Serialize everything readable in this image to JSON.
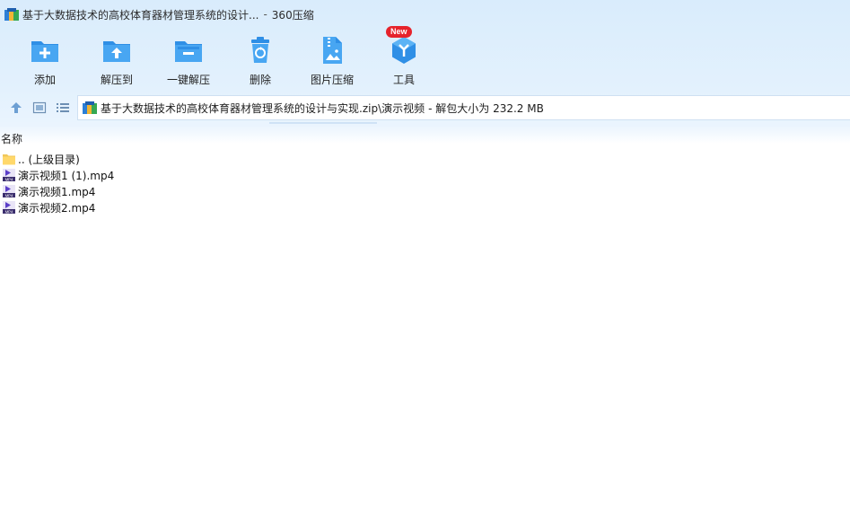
{
  "window": {
    "title": "基于大数据技术的高校体育器材管理系统的设计...",
    "separator": "-",
    "app_name": "360压缩"
  },
  "toolbar": {
    "items": [
      {
        "label": "添加",
        "icon": "add-folder-icon"
      },
      {
        "label": "解压到",
        "icon": "extract-to-icon"
      },
      {
        "label": "一键解压",
        "icon": "one-click-extract-icon"
      },
      {
        "label": "删除",
        "icon": "delete-recycle-icon"
      },
      {
        "label": "图片压缩",
        "icon": "image-compress-icon"
      },
      {
        "label": "工具",
        "icon": "tools-icon",
        "badge": "New"
      }
    ]
  },
  "navigation": {
    "path": "基于大数据技术的高校体育器材管理系统的设计与实现.zip\\演示视频",
    "info": "- 解包大小为 232.2 MB"
  },
  "list": {
    "column_name": "名称",
    "items": [
      {
        "name": ".. (上级目录)",
        "type": "parent-folder"
      },
      {
        "name": "演示视频1 (1).mp4",
        "type": "mp4"
      },
      {
        "name": "演示视频1.mp4",
        "type": "mp4"
      },
      {
        "name": "演示视频2.mp4",
        "type": "mp4"
      }
    ]
  },
  "colors": {
    "accent": "#1a8fe0",
    "badge": "#e6232b"
  }
}
